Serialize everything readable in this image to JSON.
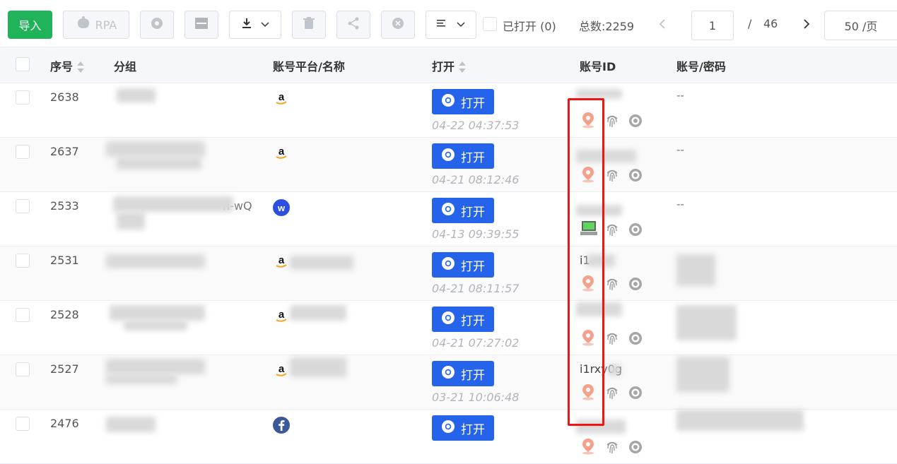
{
  "toolbar": {
    "import_label": "导入",
    "rpa_label": "RPA",
    "opened_label": "已打开 (0)",
    "total_label": "总数:2259",
    "page_current": "1",
    "page_sep": "/",
    "page_total": "46",
    "page_size": "50 /页"
  },
  "table": {
    "headers": {
      "seq": "序号",
      "group": "分组",
      "platform": "账号平台/名称",
      "open": "打开",
      "account_id": "账号ID",
      "credentials": "账号/密码"
    },
    "open_label": "打开",
    "rows": [
      {
        "seq": "2638",
        "platform": "amazon",
        "time": "04-22 04:37:53",
        "account_id": "",
        "cred": "--",
        "loc": "pin"
      },
      {
        "seq": "2637",
        "platform": "amazon",
        "time": "04-21 08:12:46",
        "account_id": "",
        "cred": "--",
        "loc": "pin"
      },
      {
        "seq": "2533",
        "platform": "w",
        "group_suffix": "n-wQ",
        "time": "04-13 09:39:55",
        "account_id": "",
        "cred": "--",
        "loc": "pc"
      },
      {
        "seq": "2531",
        "platform": "amazon",
        "time": "04-21 08:11:57",
        "account_id": "i1",
        "cred": "",
        "loc": "pin"
      },
      {
        "seq": "2528",
        "platform": "amazon",
        "time": "04-21 07:27:02",
        "account_id": "",
        "cred": "",
        "loc": "pin"
      },
      {
        "seq": "2527",
        "platform": "amazon",
        "time": "03-21 10:06:48",
        "account_id": "i1rxy0g",
        "cred": "",
        "loc": "pin"
      },
      {
        "seq": "2476",
        "platform": "facebook",
        "time": "",
        "account_id": "",
        "cred": "",
        "loc": "pin"
      }
    ]
  },
  "colors": {
    "import_green": "#21b35a",
    "open_blue": "#2563eb",
    "highlight_red": "#f01414"
  },
  "icons": [
    "download-icon",
    "chevron-down-icon",
    "trash-icon",
    "share-icon",
    "close-circle-icon",
    "list-icon",
    "chevron-left-icon",
    "chevron-right-icon",
    "chrome-icon",
    "location-pin-icon",
    "fingerprint-icon",
    "target-icon",
    "amazon-icon",
    "facebook-icon"
  ]
}
